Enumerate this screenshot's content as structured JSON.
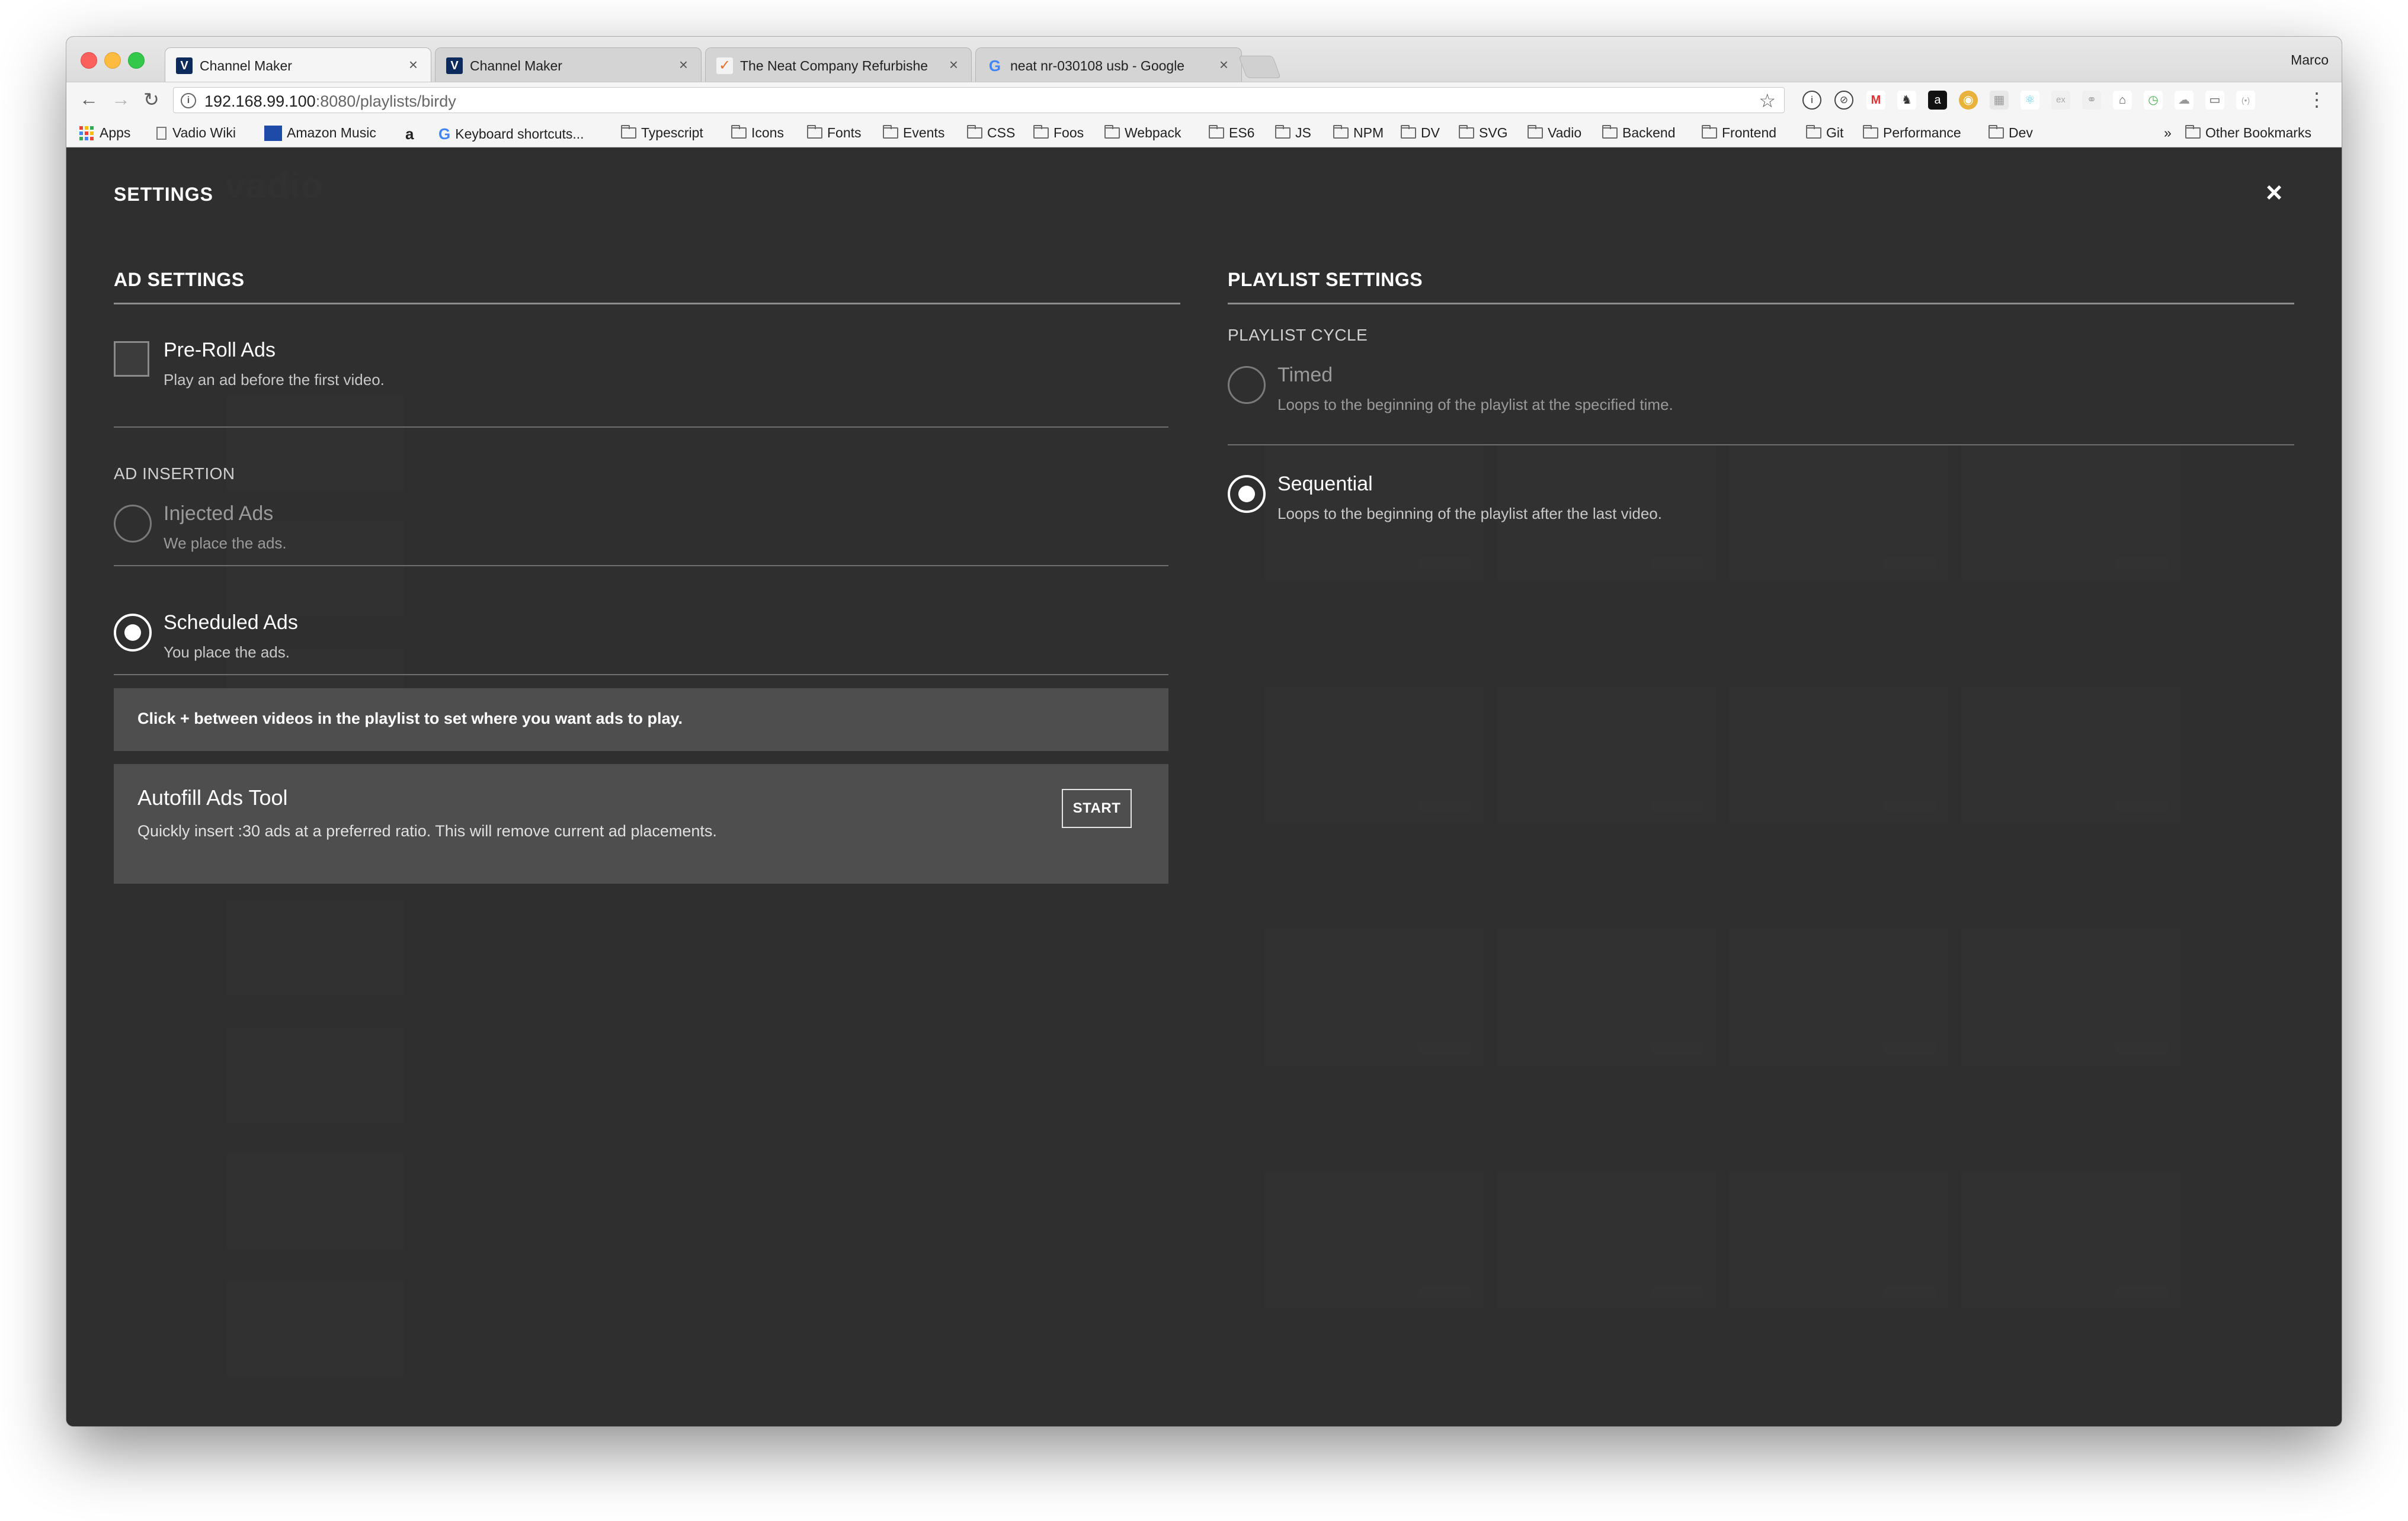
{
  "browser": {
    "tabs": [
      {
        "title": "Channel Maker",
        "favicon": "vadio-icon",
        "active": true
      },
      {
        "title": "Channel Maker",
        "favicon": "vadio-icon",
        "active": false
      },
      {
        "title": "The Neat Company Refurbishe",
        "favicon": "neat-icon",
        "active": false
      },
      {
        "title": "neat nr-030108 usb - Google",
        "favicon": "google-icon",
        "active": false
      }
    ],
    "tab_close": "×",
    "profile_name": "Marco",
    "url_host": "192.168.99.100",
    "url_path": ":8080/playlists/birdy",
    "bookmarks": {
      "apps": "Apps",
      "vadio_wiki": "Vadio Wiki",
      "amazon_music": "Amazon Music",
      "amazon": "a",
      "keyboard_shortcuts": "Keyboard shortcuts...",
      "folders": [
        "Typescript",
        "Icons",
        "Fonts",
        "Events",
        "CSS",
        "Foos",
        "Webpack",
        "ES6",
        "JS",
        "NPM",
        "DV",
        "SVG",
        "Vadio",
        "Backend",
        "Frontend",
        "Git",
        "Performance",
        "Dev"
      ],
      "overflow": "»",
      "other": "Other Bookmarks"
    }
  },
  "background_app": {
    "logo": "vadio"
  },
  "settings": {
    "title": "SETTINGS",
    "close_icon": "×",
    "ad_settings": {
      "heading": "AD SETTINGS",
      "preroll_title": "Pre-Roll Ads",
      "preroll_desc": "Play an ad before the first video.",
      "preroll_checked": false,
      "insertion_heading": "AD INSERTION",
      "injected_title": "Injected Ads",
      "injected_desc": "We place the ads.",
      "scheduled_title": "Scheduled Ads",
      "scheduled_desc": "You place the ads.",
      "selected_insertion": "scheduled",
      "info_text": "Click + between videos in the playlist to set where you want ads to play.",
      "autofill_title": "Autofill Ads Tool",
      "autofill_desc": "Quickly insert :30 ads at a preferred ratio. This will remove current ad placements.",
      "start_label": "START"
    },
    "playlist_settings": {
      "heading": "PLAYLIST SETTINGS",
      "cycle_heading": "PLAYLIST CYCLE",
      "timed_title": "Timed",
      "timed_desc": "Loops to the beginning of the playlist at the specified time.",
      "sequential_title": "Sequential",
      "sequential_desc": "Loops to the beginning of the playlist after the last video.",
      "selected_cycle": "sequential"
    }
  },
  "colors": {
    "overlay_bg": "#303030",
    "panel_bg": "#4e4e4e",
    "text": "#ffffff",
    "muted_text": "#c8c8c8"
  }
}
